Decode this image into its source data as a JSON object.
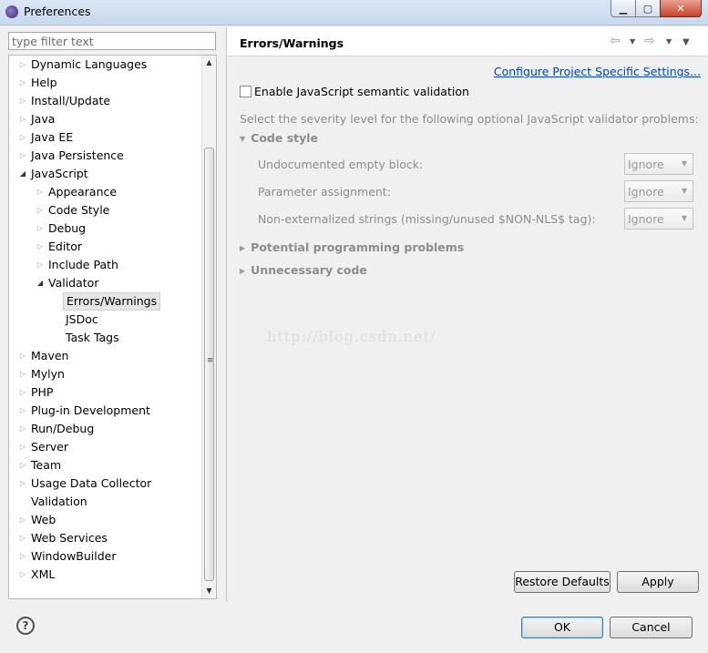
{
  "window": {
    "title": "Preferences",
    "min_symbol": "▁",
    "max_symbol": "▢",
    "close_symbol": "✕"
  },
  "filter": {
    "placeholder": "type filter text"
  },
  "tree": [
    {
      "label": "Dynamic Languages",
      "level": 0,
      "arrow": "closed"
    },
    {
      "label": "Help",
      "level": 0,
      "arrow": "closed"
    },
    {
      "label": "Install/Update",
      "level": 0,
      "arrow": "closed"
    },
    {
      "label": "Java",
      "level": 0,
      "arrow": "closed"
    },
    {
      "label": "Java EE",
      "level": 0,
      "arrow": "closed"
    },
    {
      "label": "Java Persistence",
      "level": 0,
      "arrow": "closed"
    },
    {
      "label": "JavaScript",
      "level": 0,
      "arrow": "open"
    },
    {
      "label": "Appearance",
      "level": 1,
      "arrow": "closed"
    },
    {
      "label": "Code Style",
      "level": 1,
      "arrow": "closed"
    },
    {
      "label": "Debug",
      "level": 1,
      "arrow": "closed"
    },
    {
      "label": "Editor",
      "level": 1,
      "arrow": "closed"
    },
    {
      "label": "Include Path",
      "level": 1,
      "arrow": "closed"
    },
    {
      "label": "Validator",
      "level": 1,
      "arrow": "open"
    },
    {
      "label": "Errors/Warnings",
      "level": 2,
      "arrow": "none",
      "selected": true
    },
    {
      "label": "JSDoc",
      "level": 2,
      "arrow": "none"
    },
    {
      "label": "Task Tags",
      "level": 2,
      "arrow": "none"
    },
    {
      "label": "Maven",
      "level": 0,
      "arrow": "closed"
    },
    {
      "label": "Mylyn",
      "level": 0,
      "arrow": "closed"
    },
    {
      "label": "PHP",
      "level": 0,
      "arrow": "closed"
    },
    {
      "label": "Plug-in Development",
      "level": 0,
      "arrow": "closed"
    },
    {
      "label": "Run/Debug",
      "level": 0,
      "arrow": "closed"
    },
    {
      "label": "Server",
      "level": 0,
      "arrow": "closed"
    },
    {
      "label": "Team",
      "level": 0,
      "arrow": "closed"
    },
    {
      "label": "Usage Data Collector",
      "level": 0,
      "arrow": "closed"
    },
    {
      "label": "Validation",
      "level": 0,
      "arrow": "none"
    },
    {
      "label": "Web",
      "level": 0,
      "arrow": "closed"
    },
    {
      "label": "Web Services",
      "level": 0,
      "arrow": "closed"
    },
    {
      "label": "WindowBuilder",
      "level": 0,
      "arrow": "closed"
    },
    {
      "label": "XML",
      "level": 0,
      "arrow": "closed"
    }
  ],
  "page": {
    "title": "Errors/Warnings",
    "configure_link": "Configure Project Specific Settings...",
    "enable_label": "Enable JavaScript semantic validation",
    "enable_checked": false,
    "hint": "Select the severity level for the following optional JavaScript validator problems:",
    "sections": [
      {
        "label": "Code style",
        "expanded": true
      },
      {
        "label": "Potential programming problems",
        "expanded": false
      },
      {
        "label": "Unnecessary code",
        "expanded": false
      }
    ],
    "options": [
      {
        "label": "Undocumented empty block:",
        "value": "Ignore"
      },
      {
        "label": "Parameter assignment:",
        "value": "Ignore"
      },
      {
        "label": "Non-externalized strings (missing/unused $NON-NLS$ tag):",
        "value": "Ignore"
      }
    ],
    "watermark": "http://blog.csdn.net/"
  },
  "buttons": {
    "restore": "Restore Defaults",
    "apply": "Apply",
    "ok": "OK",
    "cancel": "Cancel",
    "help": "?"
  },
  "icons": {
    "back": "back-arrow-icon",
    "forward": "forward-arrow-icon",
    "view_menu": "view-menu-icon",
    "help": "help-icon"
  }
}
